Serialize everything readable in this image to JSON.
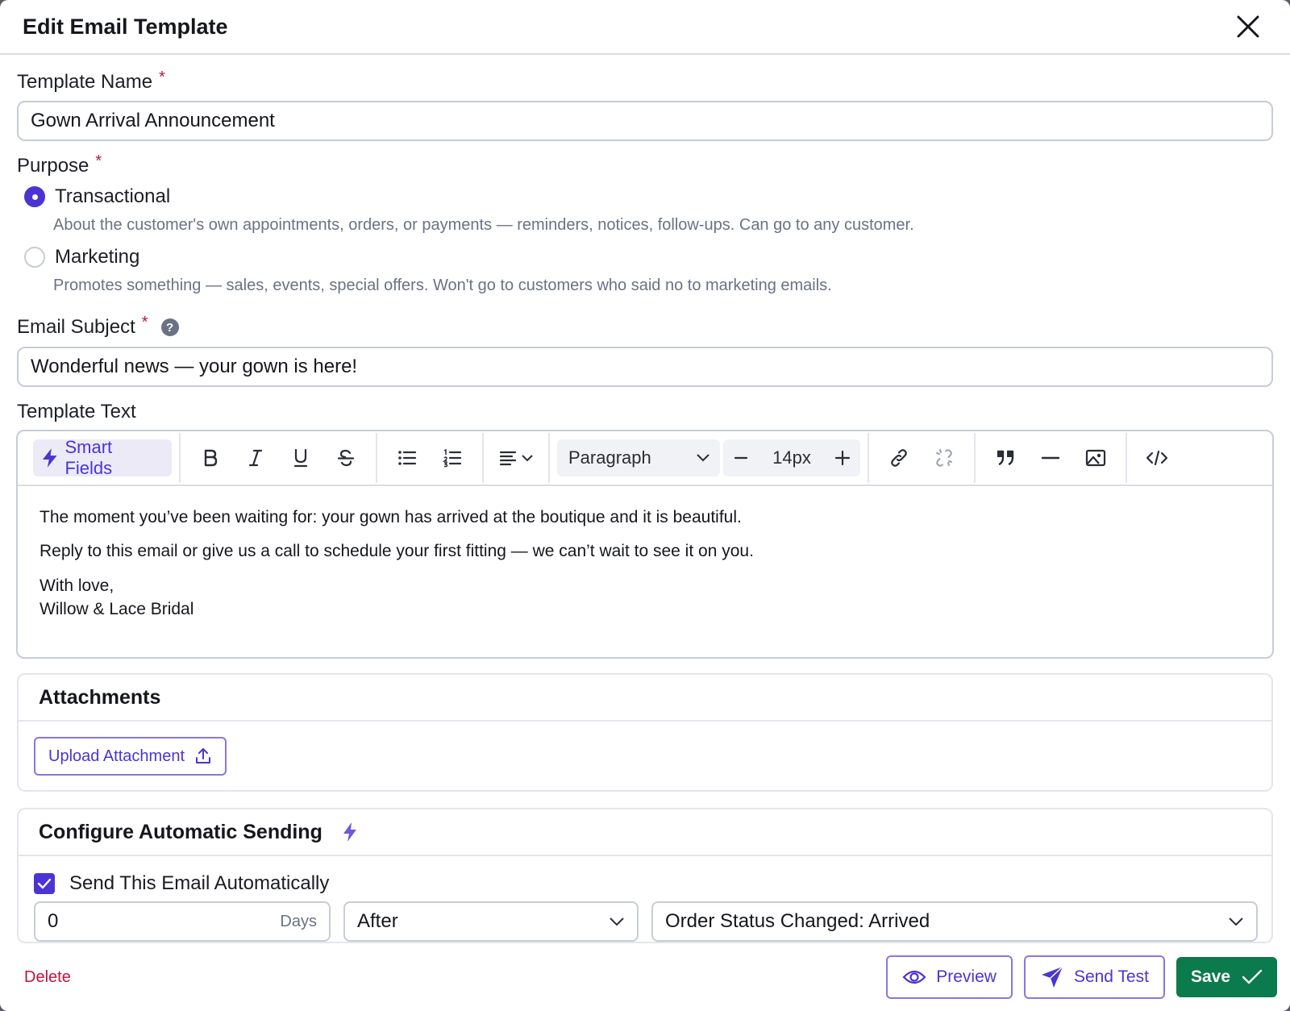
{
  "modal": {
    "title": "Edit Email Template"
  },
  "template_name": {
    "label": "Template Name",
    "required_mark": "*",
    "value": "Gown Arrival Announcement"
  },
  "purpose": {
    "label": "Purpose",
    "required_mark": "*",
    "selected": "Transactional",
    "options": [
      {
        "label": "Transactional",
        "description": "About the customer's own appointments, orders, or payments — reminders, notices, follow-ups. Can go to any customer."
      },
      {
        "label": "Marketing",
        "description": "Promotes something — sales, events, special offers. Won't go to customers who said no to marketing emails."
      }
    ]
  },
  "email_subject": {
    "label": "Email Subject",
    "required_mark": "*",
    "help_icon_glyph": "?",
    "value": "Wonderful news — your gown is here!"
  },
  "template_text": {
    "label": "Template Text",
    "toolbar": {
      "smart_fields_label": "Smart Fields",
      "block_format": "Paragraph",
      "font_size": "14px"
    },
    "content": {
      "line1": "The moment you’ve been waiting for: your gown has arrived at the boutique and it is beautiful.",
      "line2": "Reply to this email or give us a call to schedule your first fitting — we can’t wait to see it on you.",
      "line3": "With love,",
      "line4": "Willow & Lace Bridal"
    }
  },
  "attachments": {
    "title": "Attachments",
    "upload_label": "Upload Attachment"
  },
  "automatic_sending": {
    "title": "Configure Automatic Sending",
    "checkbox_label": "Send This Email Automatically",
    "checked": true,
    "days_value": "0",
    "days_suffix": "Days",
    "timing_value": "After",
    "trigger_value": "Order Status Changed: Arrived"
  },
  "footer": {
    "delete_label": "Delete",
    "preview_label": "Preview",
    "send_test_label": "Send Test",
    "save_label": "Save"
  },
  "colors": {
    "accent": "#4a35d4",
    "danger": "#c0143c",
    "save": "#0b7a4c"
  }
}
